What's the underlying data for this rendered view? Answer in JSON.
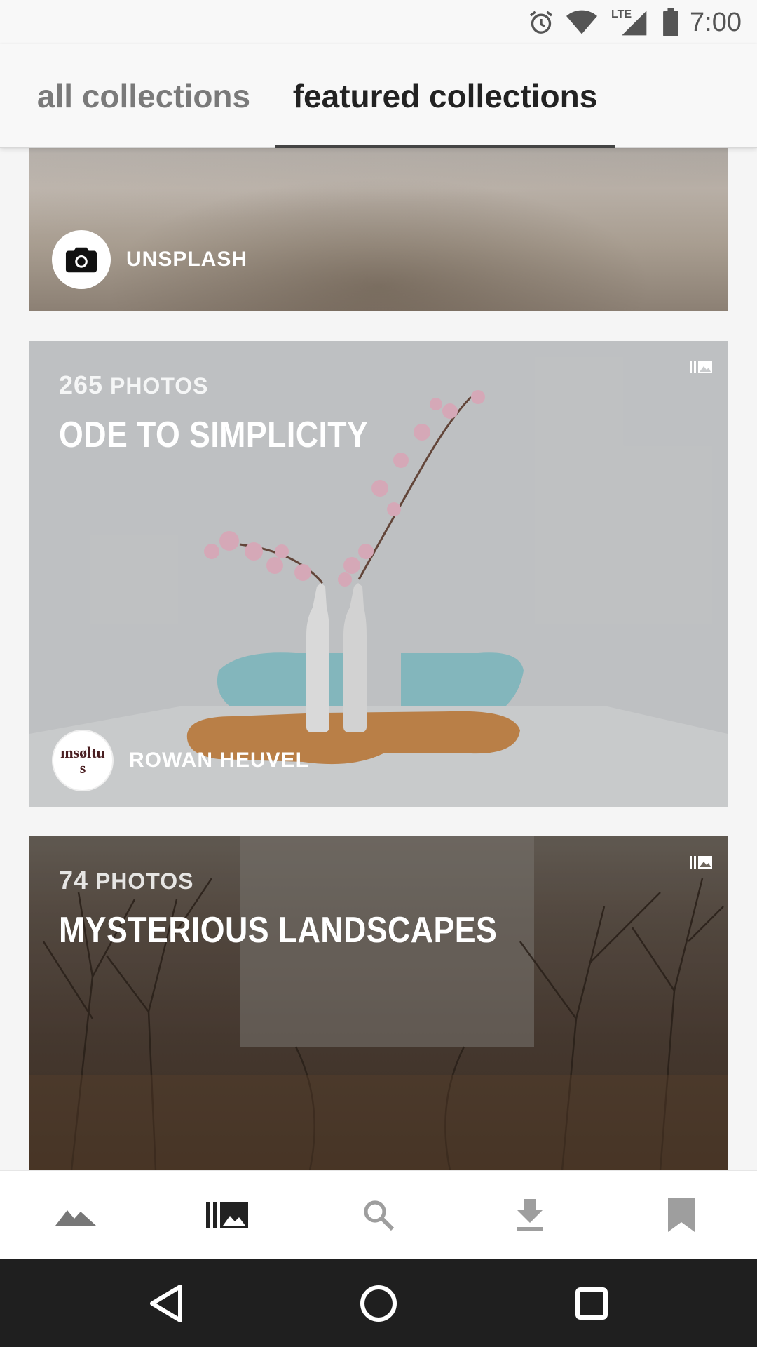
{
  "status_bar": {
    "time": "7:00",
    "network": "LTE",
    "icons": [
      "alarm-icon",
      "wifi-icon",
      "signal-icon",
      "battery-icon"
    ]
  },
  "tabs": [
    {
      "label": "all collections",
      "active": false
    },
    {
      "label": "featured collections",
      "active": true
    }
  ],
  "collections": [
    {
      "author": "UNSPLASH",
      "avatar_icon": "camera-icon"
    },
    {
      "photo_count": "265",
      "photos_label": "PHOTOS",
      "title": "ODE TO SIMPLICITY",
      "author": "ROWAN HEUVEL",
      "avatar_text": "ınsøltus",
      "collection_icon": "collection-icon"
    },
    {
      "photo_count": "74",
      "photos_label": "PHOTOS",
      "title": "MYSTERIOUS LANDSCAPES",
      "collection_icon": "collection-icon"
    }
  ],
  "bottom_nav": [
    {
      "icon": "mountain-icon",
      "active": false
    },
    {
      "icon": "collections-icon",
      "active": true
    },
    {
      "icon": "search-icon",
      "active": false
    },
    {
      "icon": "download-icon",
      "active": false
    },
    {
      "icon": "bookmark-icon",
      "active": false
    }
  ],
  "system_nav": [
    "back-icon",
    "home-icon",
    "recents-icon"
  ],
  "colors": {
    "tab_active": "#222222",
    "tab_inactive": "#7a7a7a",
    "nav_active": "#222222",
    "nav_inactive": "#9e9e9e",
    "system_bar": "#1f1f1f"
  }
}
